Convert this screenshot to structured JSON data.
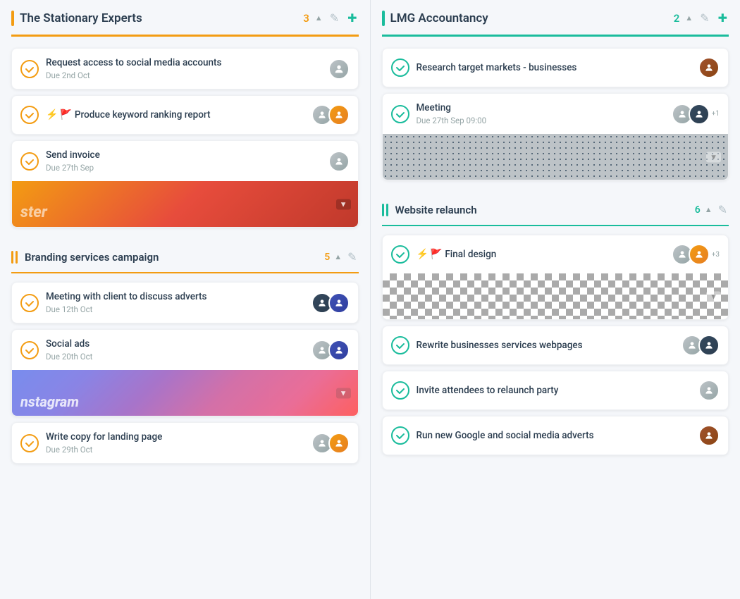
{
  "columns": [
    {
      "id": "col1",
      "title": "The Stationary Experts",
      "count": 3,
      "accent_color": "#f39c12",
      "border_class": "col-border-orange",
      "count_class": "count-orange",
      "top_class": "col-top-border-orange",
      "sections": [
        {
          "id": "s1",
          "title": null,
          "count": null,
          "accent_type": "single",
          "accent_color": "#f39c12",
          "border_class": "sec-border-none",
          "tasks": [
            {
              "id": "t1",
              "title": "Request access to social media accounts",
              "due": "Due 2nd Oct",
              "check_class": "check-orange",
              "flags": [],
              "avatars": [
                {
                  "class": "av-gray",
                  "initials": ""
                }
              ],
              "has_image": false
            },
            {
              "id": "t2",
              "title": "Produce keyword ranking report",
              "due": null,
              "check_class": "check-orange",
              "flags": [
                "red",
                "red"
              ],
              "avatars": [
                {
                  "class": "av-gray",
                  "initials": ""
                },
                {
                  "class": "av-orange",
                  "initials": ""
                }
              ],
              "has_image": false
            },
            {
              "id": "t3",
              "title": "Send invoice",
              "due": "Due 27th Sep",
              "check_class": "check-orange",
              "flags": [],
              "avatars": [
                {
                  "class": "av-gray",
                  "initials": ""
                }
              ],
              "has_image": true,
              "image_class": "img-stationery"
            }
          ]
        }
      ]
    },
    {
      "id": "col2",
      "title": "LMG Accountancy",
      "count": 2,
      "accent_color": "#1abc9c",
      "border_class": "col-border-teal",
      "count_class": "count-teal",
      "top_class": "col-top-border-teal",
      "sections": [
        {
          "id": "s2",
          "title": null,
          "count": null,
          "accent_type": "single",
          "accent_color": "#1abc9c",
          "border_class": "sec-border-none",
          "tasks": [
            {
              "id": "t4",
              "title": "Research target markets - businesses",
              "due": null,
              "check_class": "check-teal",
              "flags": [],
              "avatars": [
                {
                  "class": "av-brown",
                  "initials": ""
                }
              ],
              "has_image": false
            },
            {
              "id": "t5",
              "title": "Meeting",
              "due": "Due 27th Sep 09:00",
              "check_class": "check-teal",
              "flags": [],
              "avatars": [
                {
                  "class": "av-gray",
                  "initials": ""
                },
                {
                  "class": "av-dark",
                  "initials": ""
                }
              ],
              "avatar_extra": "+1",
              "has_image": true,
              "image_class": "img-dots"
            }
          ]
        },
        {
          "id": "s3",
          "title": "Website relaunch",
          "count": 6,
          "accent_type": "double",
          "accent_color": "#1abc9c",
          "border_class": "sec-border-teal",
          "count_class": "count-teal",
          "tasks": [
            {
              "id": "t6",
              "title": "Final design",
              "due": null,
              "check_class": "check-teal",
              "flags": [
                "red",
                "red"
              ],
              "avatars": [
                {
                  "class": "av-gray",
                  "initials": ""
                },
                {
                  "class": "av-orange",
                  "initials": ""
                }
              ],
              "avatar_extra": "+3",
              "has_image": true,
              "image_class": "img-checkered"
            },
            {
              "id": "t7",
              "title": "Rewrite businesses services webpages",
              "due": null,
              "check_class": "check-teal",
              "flags": [],
              "avatars": [
                {
                  "class": "av-gray",
                  "initials": ""
                },
                {
                  "class": "av-dark",
                  "initials": ""
                }
              ],
              "has_image": false
            },
            {
              "id": "t8",
              "title": "Invite attendees to relaunch party",
              "due": null,
              "check_class": "check-teal",
              "flags": [],
              "avatars": [
                {
                  "class": "av-gray",
                  "initials": ""
                }
              ],
              "has_image": false
            },
            {
              "id": "t9",
              "title": "Run new Google and social media adverts",
              "due": null,
              "check_class": "check-teal",
              "flags": [],
              "avatars": [
                {
                  "class": "av-brown",
                  "initials": ""
                }
              ],
              "has_image": false
            }
          ]
        }
      ]
    }
  ],
  "branding_section": {
    "title": "Branding services campaign",
    "count": 5,
    "accent_color": "#f39c12",
    "count_class": "count-orange",
    "tasks": [
      {
        "id": "b1",
        "title": "Meeting with client to discuss adverts",
        "due": "Due 12th Oct",
        "check_class": "check-orange",
        "flags": [],
        "avatars": [
          {
            "class": "av-dark",
            "initials": ""
          },
          {
            "class": "av-indigo",
            "initials": ""
          }
        ],
        "has_image": false
      },
      {
        "id": "b2",
        "title": "Social ads",
        "due": "Due 20th Oct",
        "check_class": "check-orange",
        "flags": [],
        "avatars": [
          {
            "class": "av-gray",
            "initials": ""
          },
          {
            "class": "av-indigo",
            "initials": ""
          }
        ],
        "has_image": true,
        "image_class": "img-instagram"
      },
      {
        "id": "b3",
        "title": "Write copy for landing page",
        "due": "Due 29th Oct",
        "check_class": "check-orange",
        "flags": [],
        "avatars": [
          {
            "class": "av-gray",
            "initials": ""
          },
          {
            "class": "av-orange",
            "initials": ""
          }
        ],
        "has_image": false
      }
    ]
  },
  "icons": {
    "chevron_up": "▲",
    "chevron_down": "▼",
    "edit": "✎",
    "plus": "✚",
    "flag_red": "🚩",
    "flag_marker": "⚑",
    "checkmark": "✓"
  }
}
